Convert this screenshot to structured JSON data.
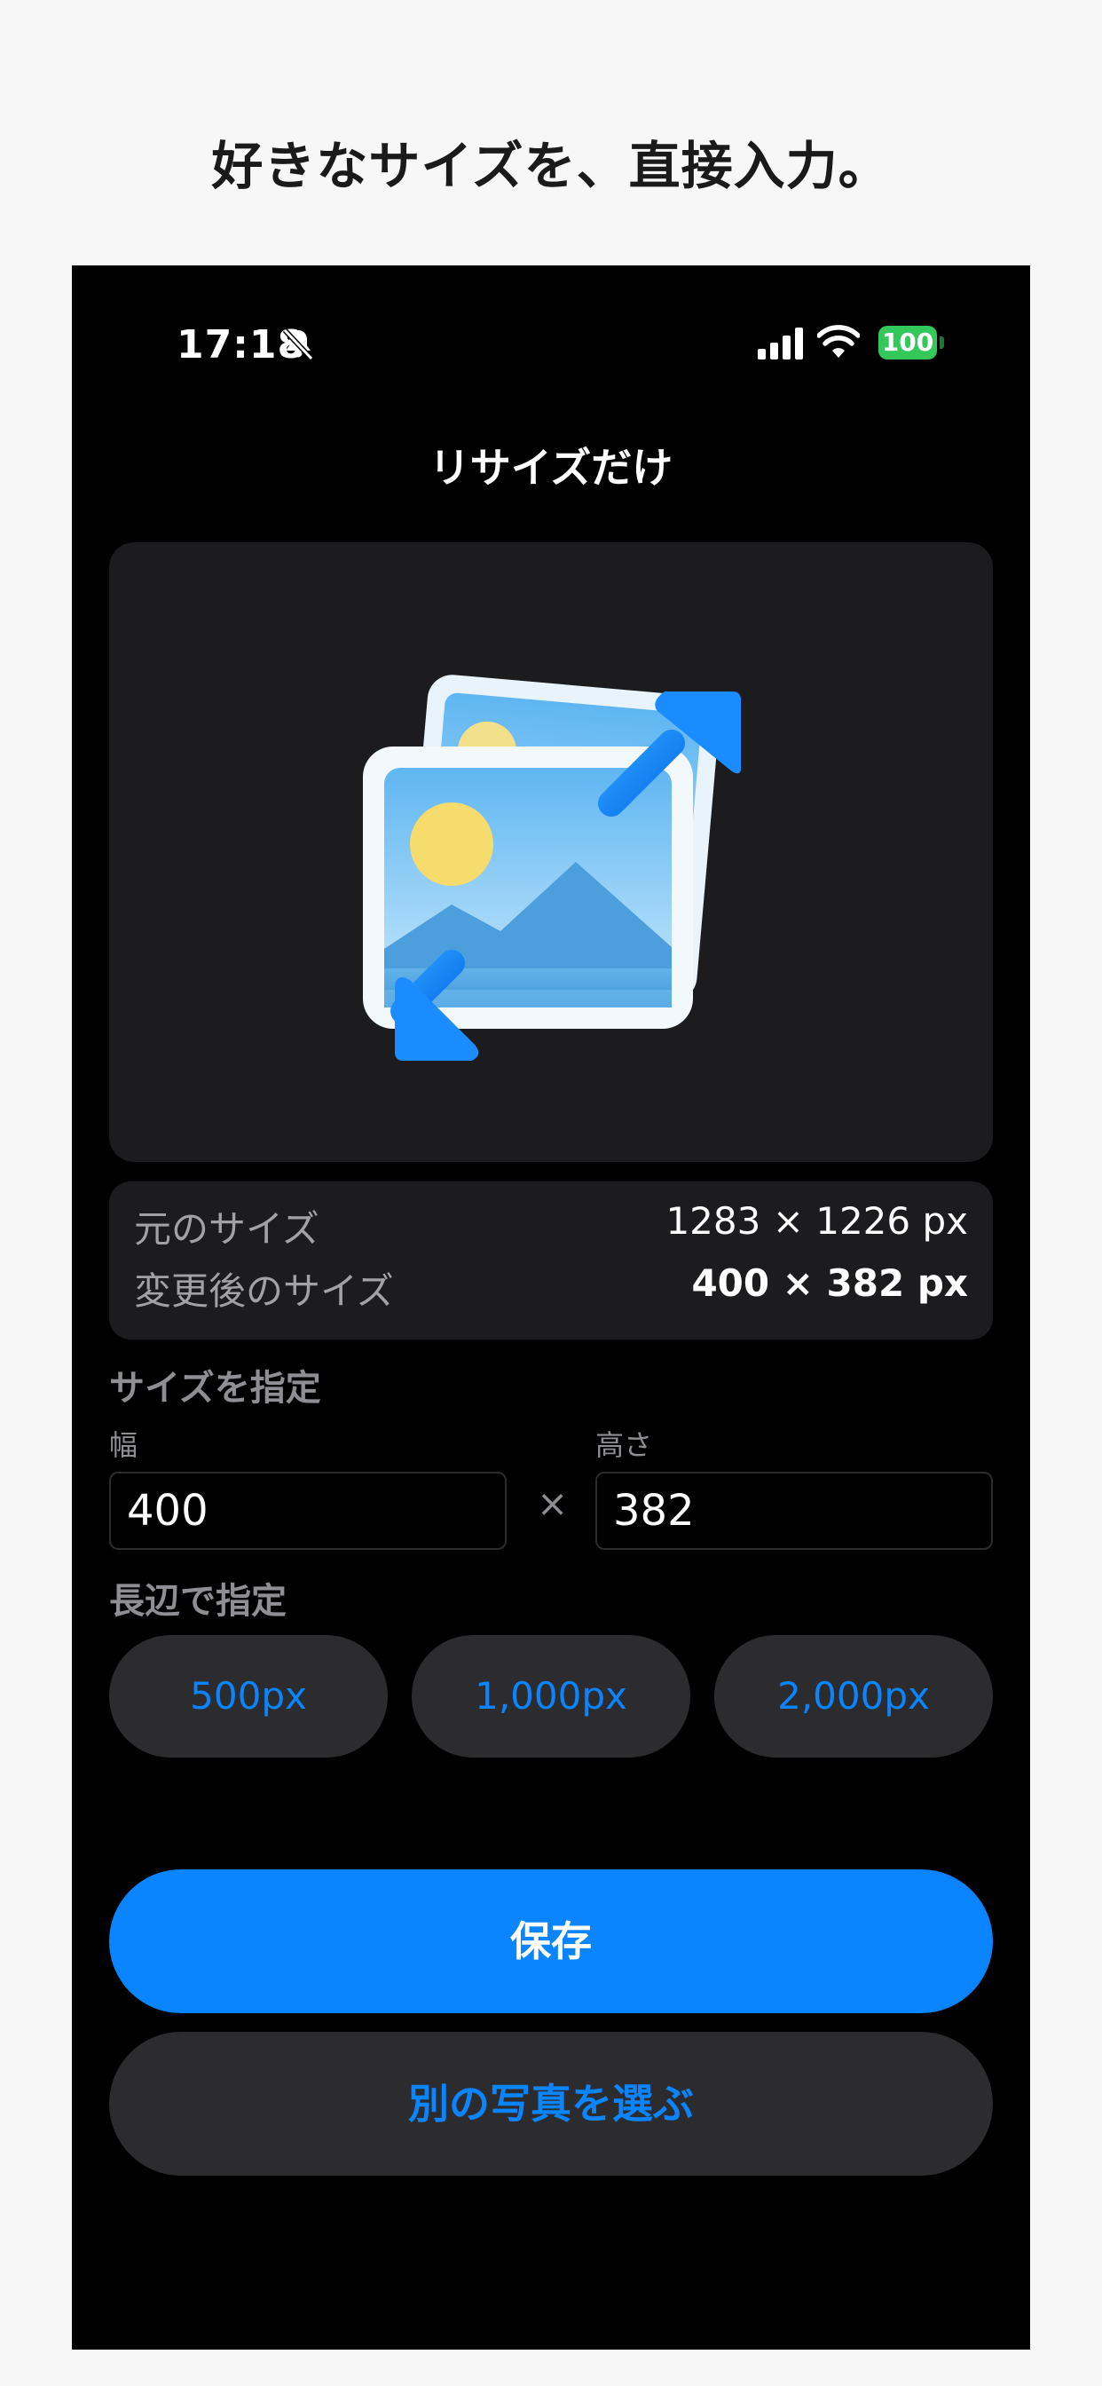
{
  "headline": "好きなサイズを、直接入力。",
  "status_bar": {
    "time": "17:18",
    "battery": "100",
    "icons": [
      "bell-slash-icon",
      "cellular-signal-icon",
      "wifi-icon",
      "battery-icon"
    ]
  },
  "nav": {
    "title": "リサイズだけ"
  },
  "preview": {
    "icon": "image-resize-icon"
  },
  "info": {
    "original_label": "元のサイズ",
    "original_value": "1283 × 1226 px",
    "resized_label": "変更後のサイズ",
    "resized_value": "400 × 382 px"
  },
  "size_spec": {
    "section_title": "サイズを指定",
    "width_label": "幅",
    "width_value": "400",
    "times": "×",
    "height_label": "高さ",
    "height_value": "382"
  },
  "long_side": {
    "section_title": "長辺で指定",
    "presets": [
      "500px",
      "1,000px",
      "2,000px"
    ]
  },
  "actions": {
    "save_label": "保存",
    "choose_label": "別の写真を選ぶ"
  },
  "colors": {
    "accent": "#0a84ff",
    "battery": "#34c759",
    "card": "#1c1c1e",
    "button_secondary": "#2c2c2e"
  }
}
